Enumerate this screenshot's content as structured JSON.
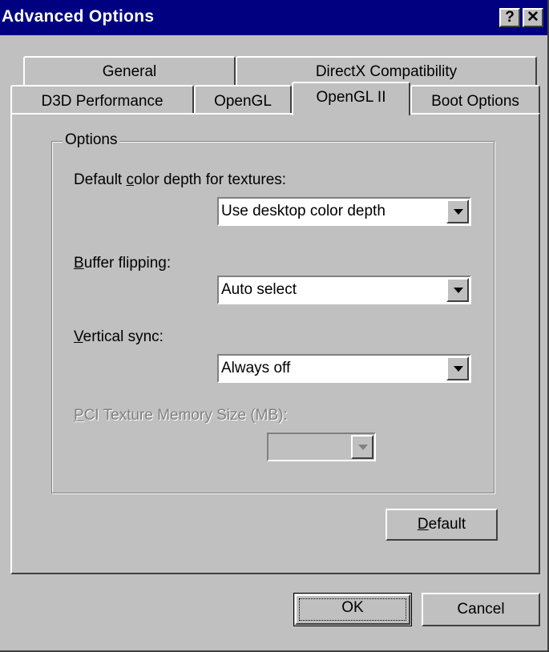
{
  "window": {
    "title": "Advanced Options",
    "help_label": "?",
    "close_label": "✕"
  },
  "tabs": {
    "row_back": [
      "General",
      "DirectX Compatibility"
    ],
    "row_front": [
      "D3D Performance",
      "OpenGL",
      "OpenGL II",
      "Boot Options"
    ],
    "active": "OpenGL II"
  },
  "options": {
    "group_label": "Options",
    "color_depth": {
      "label_pre": "Default ",
      "label_key": "c",
      "label_post": "olor depth for textures:",
      "value": "Use desktop color depth"
    },
    "buffer_flipping": {
      "label_key": "B",
      "label_post": "uffer flipping:",
      "value": "Auto select"
    },
    "vertical_sync": {
      "label_key": "V",
      "label_post": "ertical sync:",
      "value": "Always off"
    },
    "pci_memory": {
      "label_key": "P",
      "label_post": "CI Texture Memory Size (MB):",
      "value": "",
      "enabled": false
    }
  },
  "buttons": {
    "default_key": "D",
    "default_post": "efault",
    "ok": "OK",
    "cancel": "Cancel"
  }
}
